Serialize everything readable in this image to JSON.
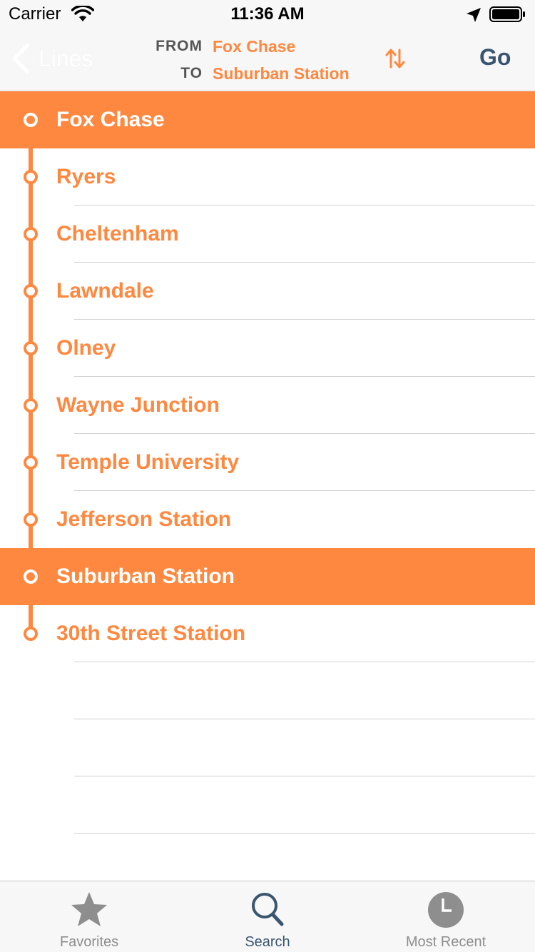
{
  "status_bar": {
    "carrier": "Carrier",
    "time": "11:36 AM"
  },
  "nav": {
    "back_label": "Lines",
    "from_label": "FROM",
    "to_label": "TO",
    "from_value": "Fox Chase",
    "to_value": "Suburban Station",
    "go_label": "Go"
  },
  "stations": [
    {
      "name": "Fox Chase",
      "selected": true
    },
    {
      "name": "Ryers",
      "selected": false
    },
    {
      "name": "Cheltenham",
      "selected": false
    },
    {
      "name": "Lawndale",
      "selected": false
    },
    {
      "name": "Olney",
      "selected": false
    },
    {
      "name": "Wayne Junction",
      "selected": false
    },
    {
      "name": "Temple University",
      "selected": false
    },
    {
      "name": "Jefferson Station",
      "selected": false
    },
    {
      "name": "Suburban Station",
      "selected": true
    },
    {
      "name": "30th Street Station",
      "selected": false
    }
  ],
  "tabs": [
    {
      "label": "Favorites",
      "icon": "star-icon",
      "active": false
    },
    {
      "label": "Search",
      "icon": "search-icon",
      "active": true
    },
    {
      "label": "Most Recent",
      "icon": "clock-icon",
      "active": false
    }
  ],
  "colors": {
    "accent": "#ff8840",
    "nav_text": "#3a5570",
    "inactive_tab": "#8e8e8e"
  }
}
